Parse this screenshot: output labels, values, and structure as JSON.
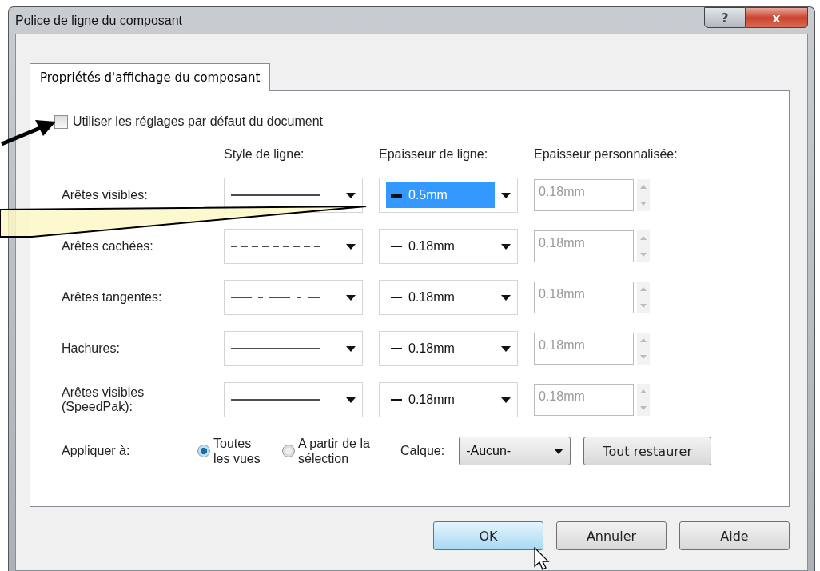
{
  "window": {
    "title": "Police de ligne du composant",
    "help_glyph": "?",
    "close_glyph": "x"
  },
  "tabs": [
    {
      "label": "Propriétés d'affichage du composant",
      "selected": true
    }
  ],
  "use_defaults": {
    "label": "Utiliser les réglages par défaut du document",
    "checked": false
  },
  "columns": [
    "Style de ligne:",
    "Epaisseur de ligne:",
    "Epaisseur personnalisée:"
  ],
  "rows": [
    {
      "label": "Arêtes visibles:",
      "line_style": {
        "kind": "solid"
      },
      "thickness": {
        "kind": "thick",
        "value": "0.5mm",
        "selected": true
      },
      "custom": {
        "value": "0.18mm",
        "disabled": true
      }
    },
    {
      "label": "Arêtes cachées:",
      "line_style": {
        "kind": "dashed"
      },
      "thickness": {
        "kind": "thin",
        "value": "0.18mm",
        "selected": false
      },
      "custom": {
        "value": "0.18mm",
        "disabled": true
      }
    },
    {
      "label": "Arêtes tangentes:",
      "line_style": {
        "kind": "dashdot"
      },
      "thickness": {
        "kind": "thin",
        "value": "0.18mm",
        "selected": false
      },
      "custom": {
        "value": "0.18mm",
        "disabled": true
      }
    },
    {
      "label": "Hachures:",
      "line_style": {
        "kind": "solid"
      },
      "thickness": {
        "kind": "thin",
        "value": "0.18mm",
        "selected": false
      },
      "custom": {
        "value": "0.18mm",
        "disabled": true
      }
    },
    {
      "label": "Arêtes visibles (SpeedPak):",
      "line_style": {
        "kind": "solid"
      },
      "thickness": {
        "kind": "thin",
        "value": "0.18mm",
        "selected": false
      },
      "custom": {
        "value": "0.18mm",
        "disabled": true
      }
    }
  ],
  "apply": {
    "label": "Appliquer à:",
    "options": [
      {
        "label": "Toutes les vues",
        "selected": true
      },
      {
        "label": "A partir de la sélection",
        "selected": false
      }
    ],
    "layer_label": "Calque:",
    "layer_value": "-Aucun-",
    "restore_button": "Tout restaurer"
  },
  "buttons": [
    {
      "label": "OK",
      "focused": true
    },
    {
      "label": "Annuler",
      "focused": false
    },
    {
      "label": "Aide",
      "focused": false
    }
  ]
}
